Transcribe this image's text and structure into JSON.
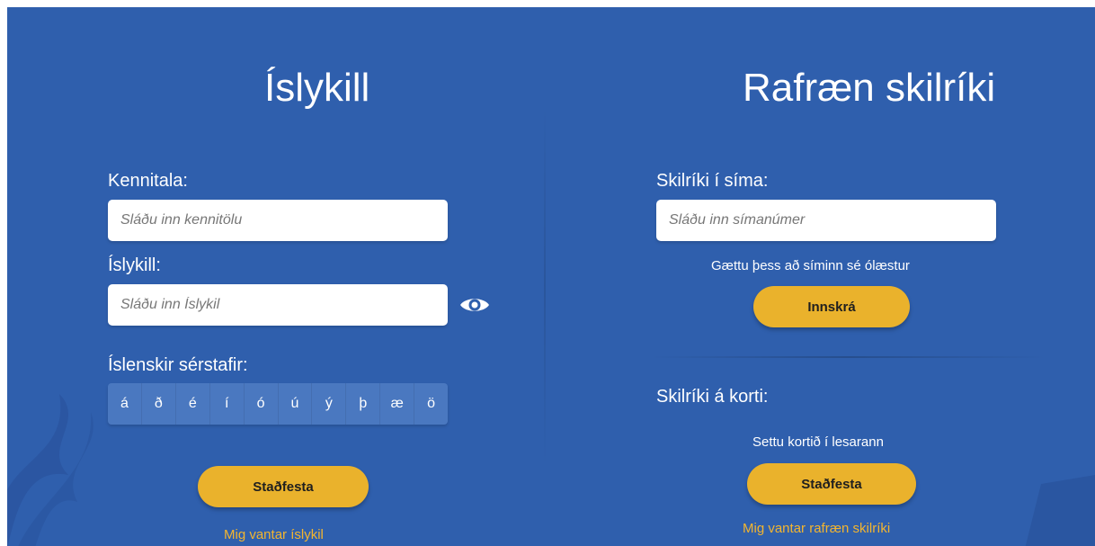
{
  "left": {
    "title": "Íslykill",
    "kennitala_label": "Kennitala:",
    "kennitala_placeholder": "Sláðu inn kennitölu",
    "islykill_label": "Íslykill:",
    "islykill_placeholder": "Sláðu inn Íslykil",
    "show_password_icon": "eye-icon",
    "special_chars_label": "Íslenskir sérstafir:",
    "special_chars": [
      "á",
      "ð",
      "é",
      "í",
      "ó",
      "ú",
      "ý",
      "þ",
      "æ",
      "ö"
    ],
    "submit_label": "Staðfesta",
    "missing_link": "Mig vantar íslykil"
  },
  "right": {
    "title": "Rafræn skilríki",
    "phone_label": "Skilríki í síma:",
    "phone_placeholder": "Sláðu inn símanúmer",
    "phone_note": "Gættu þess að síminn sé ólæstur",
    "login_label": "Innskrá",
    "card_label": "Skilríki á korti:",
    "card_note": "Settu kortið í lesarann",
    "card_submit_label": "Staðfesta",
    "missing_link": "Mig vantar rafræn skilríki"
  },
  "colors": {
    "background": "#2f5fad",
    "button": "#eab22c",
    "link": "#f3b52f",
    "char_bar": "#4a78c0"
  }
}
